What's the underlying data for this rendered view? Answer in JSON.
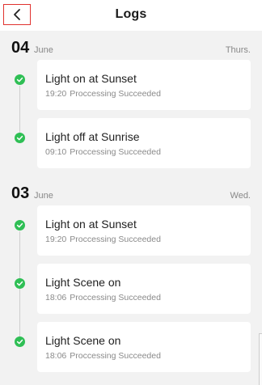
{
  "header": {
    "title": "Logs",
    "back_icon": "chevron-left-icon"
  },
  "colors": {
    "success": "#2fbf55",
    "back_button_outline": "#e0322f"
  },
  "days": [
    {
      "day": "04",
      "month": "June",
      "weekday": "Thurs.",
      "logs": [
        {
          "title": "Light on at Sunset",
          "time": "19:20",
          "status": "Proccessing Succeeded"
        },
        {
          "title": "Light off at Sunrise",
          "time": "09:10",
          "status": "Proccessing Succeeded"
        }
      ]
    },
    {
      "day": "03",
      "month": "June",
      "weekday": "Wed.",
      "logs": [
        {
          "title": "Light on at Sunset",
          "time": "19:20",
          "status": "Proccessing Succeeded"
        },
        {
          "title": "Light Scene on",
          "time": "18:06",
          "status": "Proccessing Succeeded"
        },
        {
          "title": "Light Scene on",
          "time": "18:06",
          "status": "Proccessing Succeeded"
        }
      ]
    }
  ]
}
